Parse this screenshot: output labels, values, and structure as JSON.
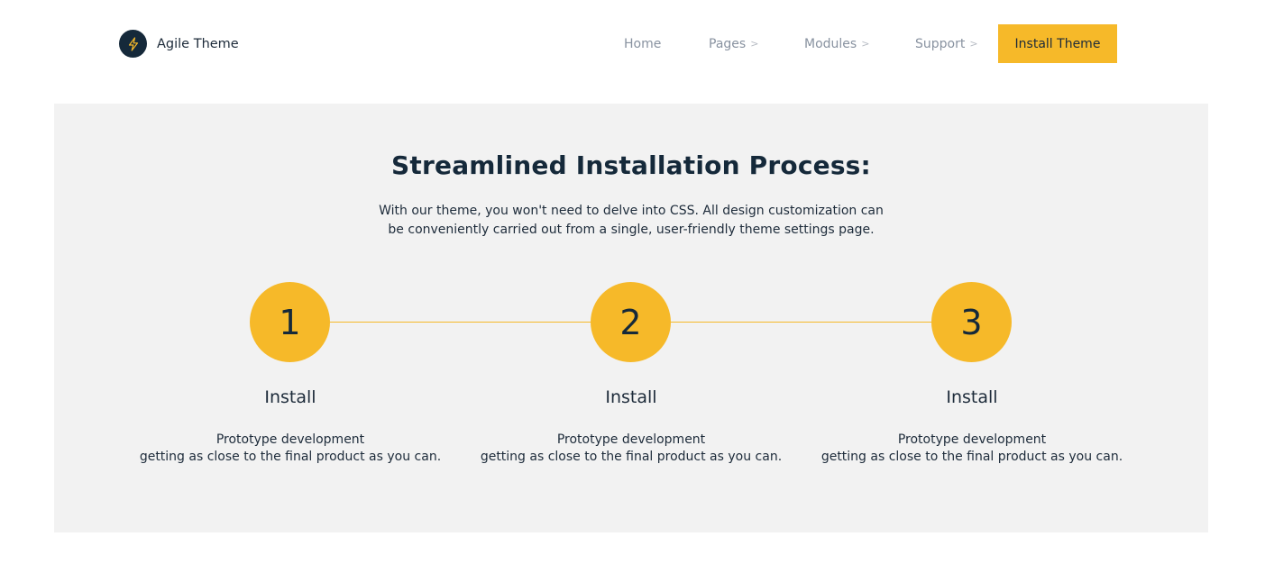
{
  "header": {
    "logo_text": "Agile Theme",
    "logo_icon": "lightning-bolt-icon",
    "nav": [
      {
        "label": "Home",
        "has_chevron": false
      },
      {
        "label": "Pages",
        "has_chevron": true
      },
      {
        "label": "Modules",
        "has_chevron": true
      },
      {
        "label": "Support",
        "has_chevron": true
      }
    ],
    "chevron_glyph": ">",
    "cta_label": "Install Theme"
  },
  "section": {
    "title": "Streamlined Installation Process:",
    "description_line1": "With our theme, you won't need to delve into CSS. All design customization can",
    "description_line2": "be conveniently carried out from a single, user-friendly theme settings page.",
    "steps": [
      {
        "number": "1",
        "title": "Install",
        "desc_line1": "Prototype development",
        "desc_line2": "getting as close to the final product as you can."
      },
      {
        "number": "2",
        "title": "Install",
        "desc_line1": "Prototype development",
        "desc_line2": "getting as close to the final product as you can."
      },
      {
        "number": "3",
        "title": "Install",
        "desc_line1": "Prototype development",
        "desc_line2": "getting as close to the final product as you can."
      }
    ]
  },
  "colors": {
    "accent": "#f6b929",
    "dark": "#15293a",
    "section_bg": "#f2f2f2",
    "nav_text": "#8892a0"
  }
}
